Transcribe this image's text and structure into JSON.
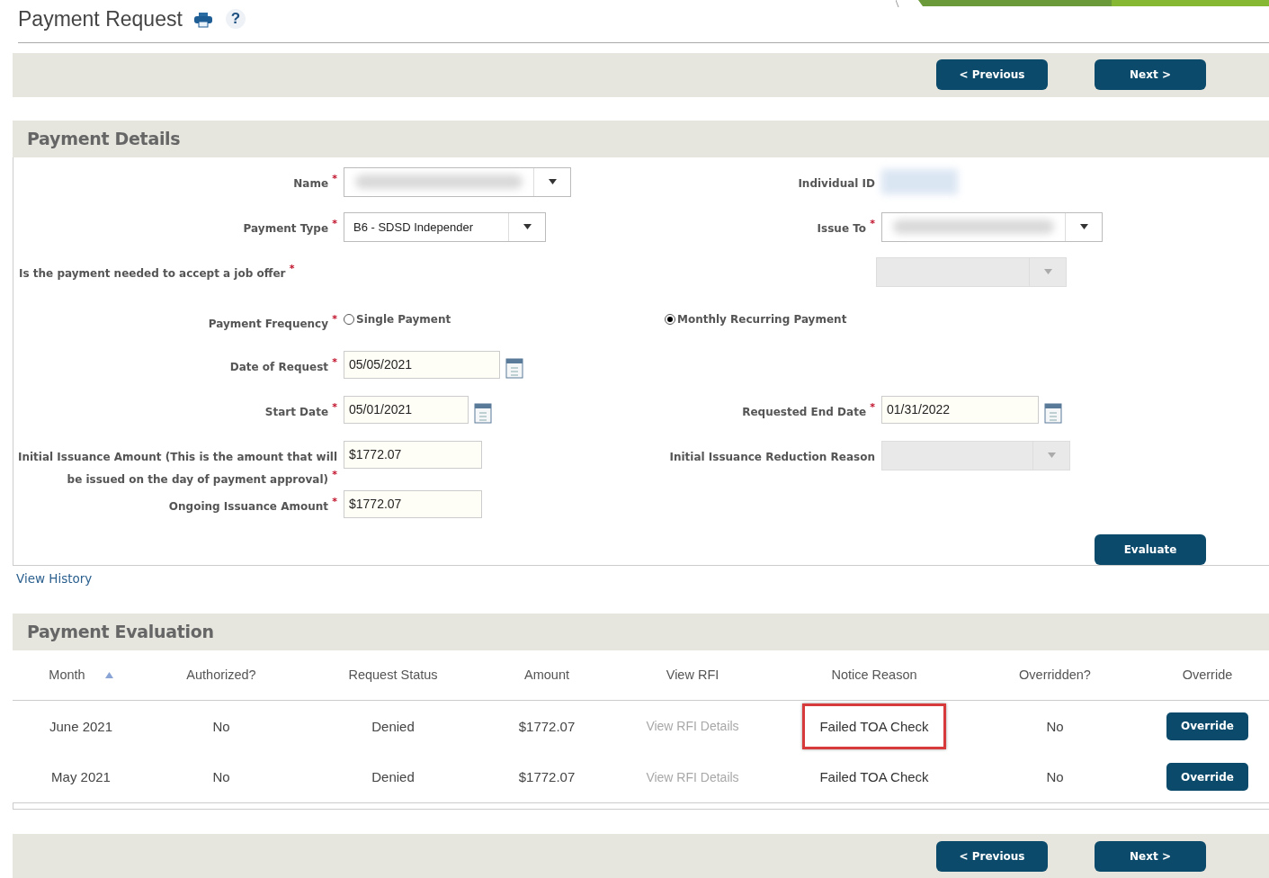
{
  "header": {
    "title": "Payment Request",
    "help_label": "?"
  },
  "top_nav": {
    "buttons": [
      "< Previous",
      "Next >"
    ]
  },
  "payment_details": {
    "title": "Payment Details",
    "rows": [
      {
        "kind": "pair",
        "left": {
          "label": "Name",
          "required_mark": "*",
          "kind": "select",
          "blurred": true
        },
        "right": {
          "label": "Individual ID",
          "kind": "readonly",
          "blurred": true
        }
      },
      {
        "kind": "pair",
        "left": {
          "label": "Payment Type",
          "required_mark": "*",
          "kind": "select",
          "value": "B6 - SDSD Independer"
        },
        "right": {
          "label": "Issue To",
          "required_mark": "*",
          "kind": "select",
          "blurred": true
        }
      },
      {
        "kind": "question",
        "label": "Is the payment needed to accept a job offer",
        "required_mark": "*",
        "disabled": true
      },
      {
        "kind": "radio",
        "label": "Payment Frequency",
        "required_mark": "*",
        "options": [
          {
            "label": "Single Payment",
            "selected": false
          },
          {
            "label": "Monthly Recurring Payment",
            "selected": true
          }
        ]
      },
      {
        "kind": "pair",
        "left": {
          "label": "Date of Request",
          "required_mark": "*",
          "kind": "date",
          "value": "05/05/2021"
        }
      },
      {
        "kind": "pair",
        "left": {
          "label": "Start Date",
          "required_mark": "*",
          "kind": "date",
          "value": "05/01/2021"
        },
        "right": {
          "label": "Requested End Date",
          "required_mark": "*",
          "kind": "date",
          "value": "01/31/2022"
        }
      },
      {
        "kind": "pair",
        "left": {
          "label": "Initial Issuance Amount (This is the amount that will be issued on the day of payment approval)",
          "required_mark": "*",
          "kind": "text",
          "value": "$1772.07"
        },
        "right": {
          "label": "Initial Issuance Reduction Reason",
          "kind": "select",
          "disabled": true
        }
      },
      {
        "kind": "pair",
        "left": {
          "label": "Ongoing Issuance Amount",
          "required_mark": "*",
          "kind": "text",
          "value": "$1772.07"
        }
      }
    ],
    "evaluate_button": "Evaluate"
  },
  "view_history_link": "View History",
  "payment_evaluation": {
    "title": "Payment Evaluation",
    "columns": [
      {
        "label": "Month",
        "sorted": true
      },
      {
        "label": "Authorized?",
        "sorted": false
      },
      {
        "label": "Request Status",
        "sorted": false
      },
      {
        "label": "Amount",
        "sorted": false
      },
      {
        "label": "View RFI",
        "sorted": false
      },
      {
        "label": "Notice Reason",
        "sorted": false
      },
      {
        "label": "Overridden?",
        "sorted": false
      },
      {
        "label": "Override",
        "sorted": false
      }
    ],
    "rows": [
      {
        "month": "June 2021",
        "authorized": "No",
        "status": "Denied",
        "amount": "$1772.07",
        "view_rfi": {
          "label": "View RFI Details",
          "disabled": true
        },
        "notice_reason": "Failed TOA Check",
        "highlighted": true,
        "overridden": "No",
        "override_button": "Override"
      },
      {
        "month": "May 2021",
        "authorized": "No",
        "status": "Denied",
        "amount": "$1772.07",
        "view_rfi": {
          "label": "View RFI Details",
          "disabled": true
        },
        "notice_reason": "Failed TOA Check",
        "highlighted": false,
        "overridden": "No",
        "override_button": "Override"
      }
    ]
  },
  "bottom_nav": {
    "buttons": [
      "< Previous",
      "Next >"
    ]
  }
}
